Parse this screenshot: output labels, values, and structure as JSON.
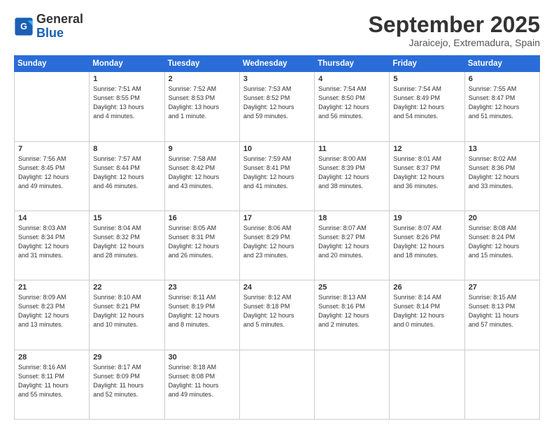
{
  "header": {
    "logo_line1": "General",
    "logo_line2": "Blue",
    "month_title": "September 2025",
    "subtitle": "Jaraicejo, Extremadura, Spain"
  },
  "weekdays": [
    "Sunday",
    "Monday",
    "Tuesday",
    "Wednesday",
    "Thursday",
    "Friday",
    "Saturday"
  ],
  "weeks": [
    [
      {
        "day": "",
        "info": ""
      },
      {
        "day": "1",
        "info": "Sunrise: 7:51 AM\nSunset: 8:55 PM\nDaylight: 13 hours\nand 4 minutes."
      },
      {
        "day": "2",
        "info": "Sunrise: 7:52 AM\nSunset: 8:53 PM\nDaylight: 13 hours\nand 1 minute."
      },
      {
        "day": "3",
        "info": "Sunrise: 7:53 AM\nSunset: 8:52 PM\nDaylight: 12 hours\nand 59 minutes."
      },
      {
        "day": "4",
        "info": "Sunrise: 7:54 AM\nSunset: 8:50 PM\nDaylight: 12 hours\nand 56 minutes."
      },
      {
        "day": "5",
        "info": "Sunrise: 7:54 AM\nSunset: 8:49 PM\nDaylight: 12 hours\nand 54 minutes."
      },
      {
        "day": "6",
        "info": "Sunrise: 7:55 AM\nSunset: 8:47 PM\nDaylight: 12 hours\nand 51 minutes."
      }
    ],
    [
      {
        "day": "7",
        "info": "Sunrise: 7:56 AM\nSunset: 8:45 PM\nDaylight: 12 hours\nand 49 minutes."
      },
      {
        "day": "8",
        "info": "Sunrise: 7:57 AM\nSunset: 8:44 PM\nDaylight: 12 hours\nand 46 minutes."
      },
      {
        "day": "9",
        "info": "Sunrise: 7:58 AM\nSunset: 8:42 PM\nDaylight: 12 hours\nand 43 minutes."
      },
      {
        "day": "10",
        "info": "Sunrise: 7:59 AM\nSunset: 8:41 PM\nDaylight: 12 hours\nand 41 minutes."
      },
      {
        "day": "11",
        "info": "Sunrise: 8:00 AM\nSunset: 8:39 PM\nDaylight: 12 hours\nand 38 minutes."
      },
      {
        "day": "12",
        "info": "Sunrise: 8:01 AM\nSunset: 8:37 PM\nDaylight: 12 hours\nand 36 minutes."
      },
      {
        "day": "13",
        "info": "Sunrise: 8:02 AM\nSunset: 8:36 PM\nDaylight: 12 hours\nand 33 minutes."
      }
    ],
    [
      {
        "day": "14",
        "info": "Sunrise: 8:03 AM\nSunset: 8:34 PM\nDaylight: 12 hours\nand 31 minutes."
      },
      {
        "day": "15",
        "info": "Sunrise: 8:04 AM\nSunset: 8:32 PM\nDaylight: 12 hours\nand 28 minutes."
      },
      {
        "day": "16",
        "info": "Sunrise: 8:05 AM\nSunset: 8:31 PM\nDaylight: 12 hours\nand 26 minutes."
      },
      {
        "day": "17",
        "info": "Sunrise: 8:06 AM\nSunset: 8:29 PM\nDaylight: 12 hours\nand 23 minutes."
      },
      {
        "day": "18",
        "info": "Sunrise: 8:07 AM\nSunset: 8:27 PM\nDaylight: 12 hours\nand 20 minutes."
      },
      {
        "day": "19",
        "info": "Sunrise: 8:07 AM\nSunset: 8:26 PM\nDaylight: 12 hours\nand 18 minutes."
      },
      {
        "day": "20",
        "info": "Sunrise: 8:08 AM\nSunset: 8:24 PM\nDaylight: 12 hours\nand 15 minutes."
      }
    ],
    [
      {
        "day": "21",
        "info": "Sunrise: 8:09 AM\nSunset: 8:23 PM\nDaylight: 12 hours\nand 13 minutes."
      },
      {
        "day": "22",
        "info": "Sunrise: 8:10 AM\nSunset: 8:21 PM\nDaylight: 12 hours\nand 10 minutes."
      },
      {
        "day": "23",
        "info": "Sunrise: 8:11 AM\nSunset: 8:19 PM\nDaylight: 12 hours\nand 8 minutes."
      },
      {
        "day": "24",
        "info": "Sunrise: 8:12 AM\nSunset: 8:18 PM\nDaylight: 12 hours\nand 5 minutes."
      },
      {
        "day": "25",
        "info": "Sunrise: 8:13 AM\nSunset: 8:16 PM\nDaylight: 12 hours\nand 2 minutes."
      },
      {
        "day": "26",
        "info": "Sunrise: 8:14 AM\nSunset: 8:14 PM\nDaylight: 12 hours\nand 0 minutes."
      },
      {
        "day": "27",
        "info": "Sunrise: 8:15 AM\nSunset: 8:13 PM\nDaylight: 11 hours\nand 57 minutes."
      }
    ],
    [
      {
        "day": "28",
        "info": "Sunrise: 8:16 AM\nSunset: 8:11 PM\nDaylight: 11 hours\nand 55 minutes."
      },
      {
        "day": "29",
        "info": "Sunrise: 8:17 AM\nSunset: 8:09 PM\nDaylight: 11 hours\nand 52 minutes."
      },
      {
        "day": "30",
        "info": "Sunrise: 8:18 AM\nSunset: 8:08 PM\nDaylight: 11 hours\nand 49 minutes."
      },
      {
        "day": "",
        "info": ""
      },
      {
        "day": "",
        "info": ""
      },
      {
        "day": "",
        "info": ""
      },
      {
        "day": "",
        "info": ""
      }
    ]
  ]
}
